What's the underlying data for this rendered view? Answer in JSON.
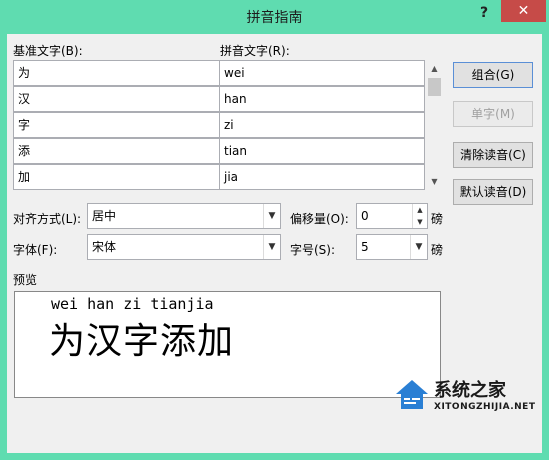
{
  "window": {
    "title": "拼音指南",
    "help": "?",
    "close": "✕"
  },
  "headers": {
    "base": "基准文字(B):",
    "ruby": "拼音文字(R):"
  },
  "rows": [
    {
      "base": "为",
      "ruby": "wei"
    },
    {
      "base": "汉",
      "ruby": "han"
    },
    {
      "base": "字",
      "ruby": "zi"
    },
    {
      "base": "添",
      "ruby": "tian"
    },
    {
      "base": "加",
      "ruby": "jia"
    }
  ],
  "buttons": {
    "group": "组合(G)",
    "mono": "单字(M)",
    "clear": "清除读音(C)",
    "default": "默认读音(D)"
  },
  "align": {
    "label": "对齐方式(L):",
    "value": "居中"
  },
  "offset": {
    "label": "偏移量(O):",
    "value": "0",
    "unit": "磅"
  },
  "font": {
    "label": "字体(F):",
    "value": "宋体"
  },
  "size": {
    "label": "字号(S):",
    "value": "5",
    "unit": "磅"
  },
  "preview": {
    "label": "预览",
    "ruby_text": "wei han zi tianjia",
    "base_text": "为汉字添加"
  },
  "watermark": {
    "title": "系统之家",
    "url": "XITONGZHIJIA.NET"
  },
  "colors": {
    "titlebar": "#5fdcb0",
    "close": "#c64b48",
    "accent_border": "#5a8fd6"
  }
}
